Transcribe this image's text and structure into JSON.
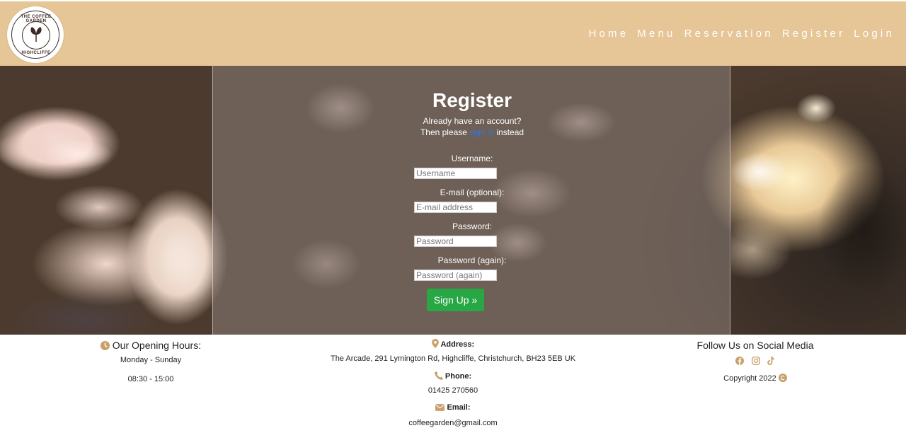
{
  "header": {
    "logo_text_top": "THE COFFEE GARDEN",
    "logo_text_bottom": "HIGHCLIFFE",
    "nav": [
      {
        "label": "Home"
      },
      {
        "label": "Menu"
      },
      {
        "label": "Reservation"
      },
      {
        "label": "Register"
      },
      {
        "label": "Login"
      }
    ]
  },
  "register": {
    "title": "Register",
    "line1": "Already have an account?",
    "line2_prefix": "Then please ",
    "line2_link": "sign in",
    "line2_suffix": " instead",
    "fields": [
      {
        "label": "Username:",
        "placeholder": "Username"
      },
      {
        "label": "E-mail (optional):",
        "placeholder": "E-mail address"
      },
      {
        "label": "Password:",
        "placeholder": "Password"
      },
      {
        "label": "Password (again):",
        "placeholder": "Password (again)"
      }
    ],
    "submit_label": "Sign Up »"
  },
  "footer": {
    "hours": {
      "title": "Our Opening Hours:",
      "days": "Monday - Sunday",
      "time": "08:30 - 15:00"
    },
    "contact": {
      "address_label": "Address:",
      "address": "The Arcade, 291 Lymington Rd, Highcliffe, Christchurch, BH23 5EB UK",
      "phone_label": "Phone:",
      "phone": "01425 270560",
      "email_label": "Email:",
      "email": "coffeegarden@gmail.com"
    },
    "social": {
      "title": "Follow Us on Social Media",
      "icons": [
        "facebook-icon",
        "instagram-icon",
        "tiktok-icon"
      ],
      "copyright": "Copyright 2022"
    }
  },
  "colors": {
    "header_bg": "#e6c596",
    "accent_icon": "#c9a06a",
    "signup_green": "#28a745",
    "link_blue": "#2a7ae2"
  }
}
